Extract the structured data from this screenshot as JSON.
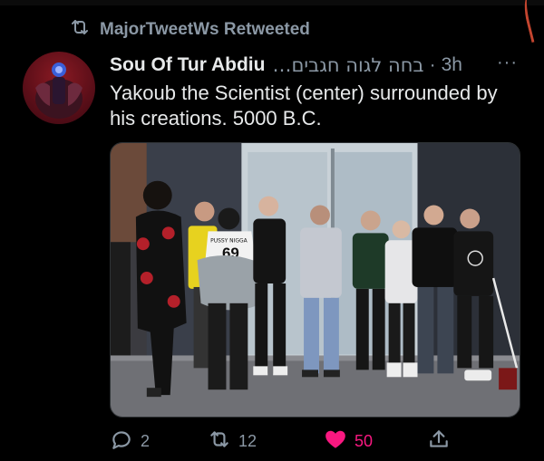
{
  "retweet_banner": {
    "label": "MajorTweetWs Retweeted",
    "icon": "retweet-icon"
  },
  "tweet": {
    "display_name": "Sou Of Tur Abdiu",
    "native_name": "בחה לגוה חגבים…",
    "separator": "·",
    "time": "3h",
    "more_icon": "more-horizontal-icon",
    "text": "Yakoub the Scientist (center) surrounded by his creations. 5000 B.C.",
    "jacket_text_small": "PUSSY NIGGA",
    "jacket_number": "69"
  },
  "actions": {
    "reply_count": "2",
    "retweet_count": "12",
    "like_count": "50",
    "liked_color": "#f91880"
  },
  "colors": {
    "background": "#000000",
    "text": "#e7e9ea",
    "muted": "#8b98a5"
  }
}
